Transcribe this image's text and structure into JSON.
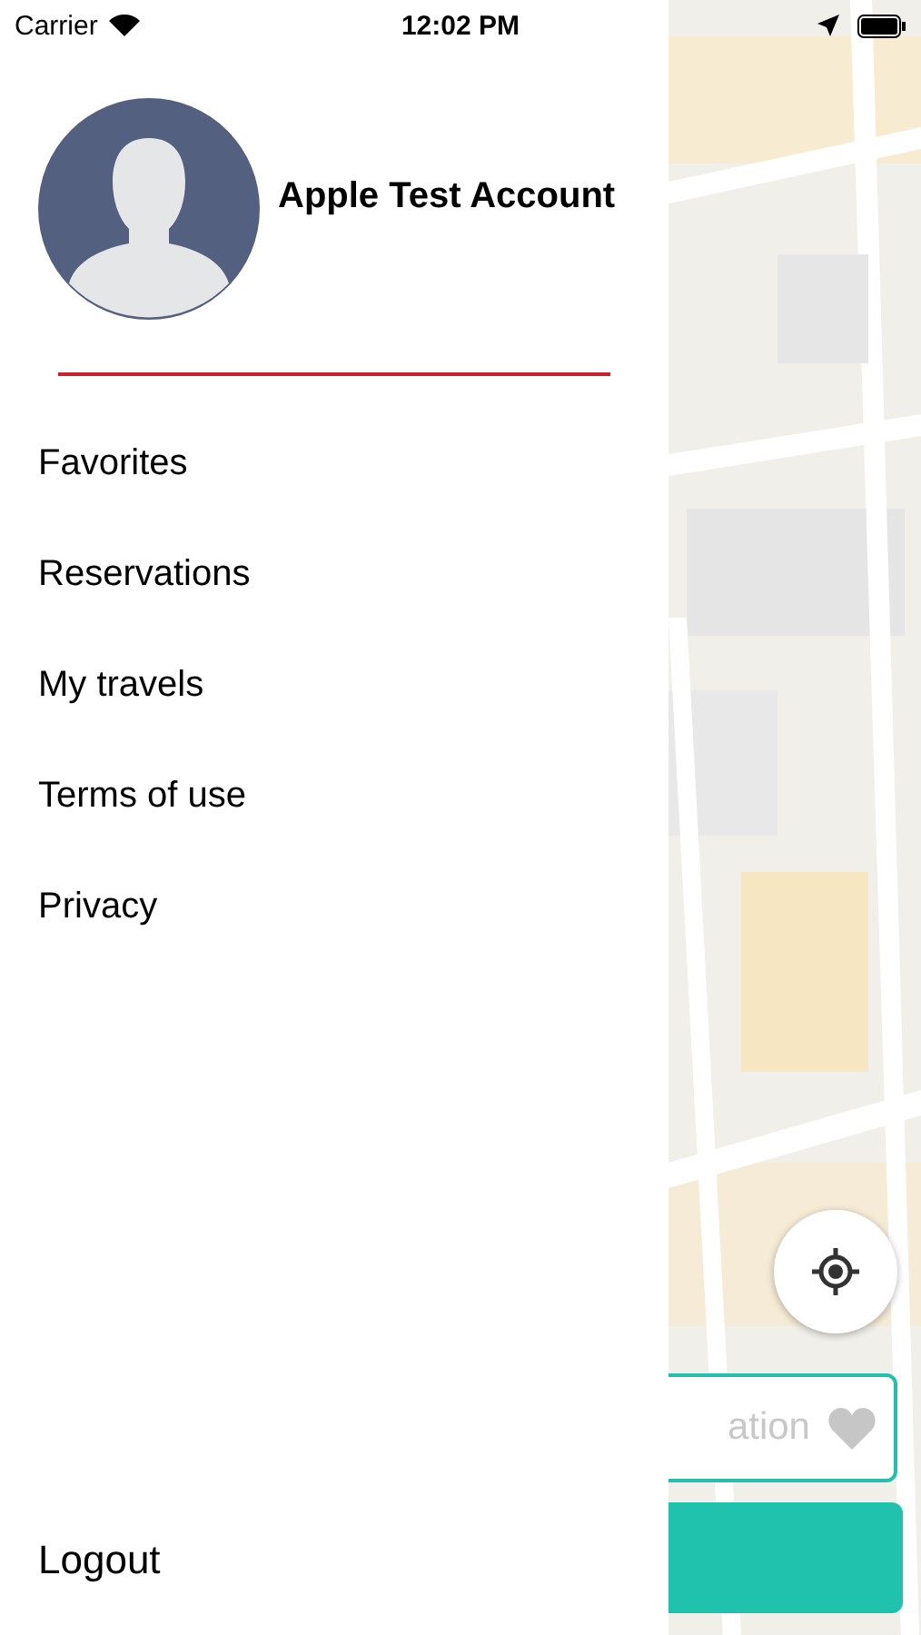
{
  "status_bar": {
    "carrier": "Carrier",
    "time": "12:02 PM"
  },
  "profile": {
    "name": "Apple Test Account"
  },
  "menu": [
    {
      "label": "Favorites"
    },
    {
      "label": "Reservations"
    },
    {
      "label": "My travels"
    },
    {
      "label": "Terms of use"
    },
    {
      "label": "Privacy"
    }
  ],
  "logout": "Logout",
  "map": {
    "kind": "picture",
    "search": {
      "placeholder": "ation"
    }
  }
}
